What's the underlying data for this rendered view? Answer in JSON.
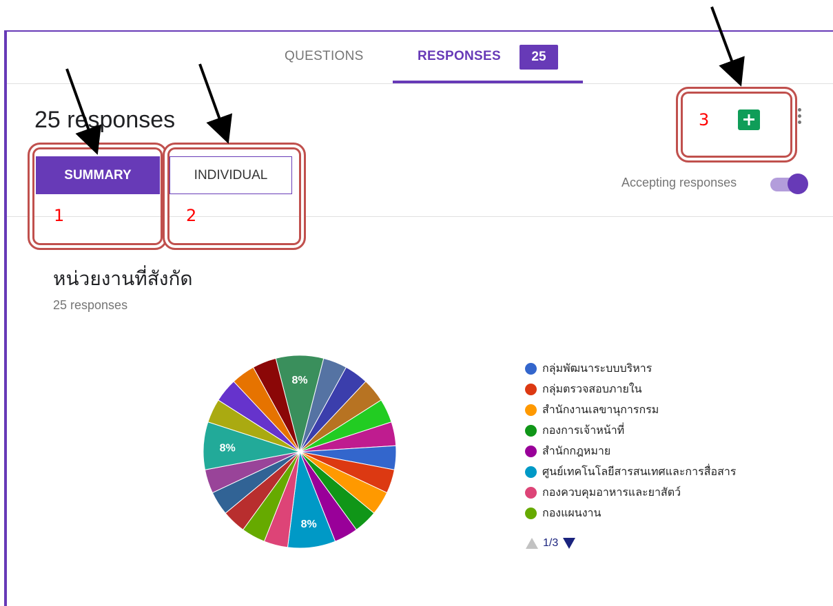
{
  "tabs": {
    "questions_label": "QUESTIONS",
    "responses_label": "RESPONSES",
    "responses_badge": "25"
  },
  "summary_header": {
    "response_count_text": "25 responses",
    "summary_label": "SUMMARY",
    "individual_label": "INDIVIDUAL",
    "accepting_label": "Accepting responses",
    "accepting_on": true,
    "sheets_icon": "google-sheets-icon",
    "more_icon": "more-vert-icon"
  },
  "annotations": {
    "labels": [
      "1",
      "2",
      "3"
    ],
    "color": "#c0504d"
  },
  "question": {
    "title": "หน่วยงานที่สังกัด",
    "subtitle": "25 responses"
  },
  "chart_data": {
    "type": "pie",
    "slices": [
      {
        "value": 8,
        "color": "#3a8f5c",
        "label": "8%"
      },
      {
        "value": 4,
        "color": "#5573a3",
        "label": ""
      },
      {
        "value": 4,
        "color": "#3b3eac",
        "label": ""
      },
      {
        "value": 4,
        "color": "#b77322",
        "label": ""
      },
      {
        "value": 4,
        "color": "#22cc22",
        "label": ""
      },
      {
        "value": 4,
        "color": "#bf1c8f",
        "label": ""
      },
      {
        "value": 4,
        "color": "#3366cc",
        "label": ""
      },
      {
        "value": 4,
        "color": "#dc3912",
        "label": ""
      },
      {
        "value": 4,
        "color": "#ff9900",
        "label": ""
      },
      {
        "value": 4,
        "color": "#109618",
        "label": ""
      },
      {
        "value": 4,
        "color": "#990099",
        "label": ""
      },
      {
        "value": 8,
        "color": "#0099c6",
        "label": "8%"
      },
      {
        "value": 4,
        "color": "#dd4477",
        "label": ""
      },
      {
        "value": 4,
        "color": "#66aa00",
        "label": ""
      },
      {
        "value": 4,
        "color": "#b82e2e",
        "label": ""
      },
      {
        "value": 4,
        "color": "#316395",
        "label": ""
      },
      {
        "value": 4,
        "color": "#994499",
        "label": ""
      },
      {
        "value": 8,
        "color": "#22aa99",
        "label": "8%"
      },
      {
        "value": 4,
        "color": "#aaaa11",
        "label": ""
      },
      {
        "value": 4,
        "color": "#6633cc",
        "label": ""
      },
      {
        "value": 4,
        "color": "#e67300",
        "label": ""
      },
      {
        "value": 4,
        "color": "#8b0707",
        "label": ""
      }
    ],
    "legend": [
      {
        "label": "กลุ่มพัฒนาระบบบริหาร",
        "color": "#3366cc"
      },
      {
        "label": "กลุ่มตรวจสอบภายใน",
        "color": "#dc3912"
      },
      {
        "label": "สำนักงานเลขานุการกรม",
        "color": "#ff9900"
      },
      {
        "label": "กองการเจ้าหน้าที่",
        "color": "#109618"
      },
      {
        "label": "สำนักกฎหมาย",
        "color": "#990099"
      },
      {
        "label": "ศูนย์เทคโนโลยีสารสนเทศและการสื่อสาร",
        "color": "#0099c6"
      },
      {
        "label": "กองควบคุมอาหารและยาสัตว์",
        "color": "#dd4477"
      },
      {
        "label": "กองแผนงาน",
        "color": "#66aa00"
      }
    ],
    "legend_page": "1/3"
  }
}
